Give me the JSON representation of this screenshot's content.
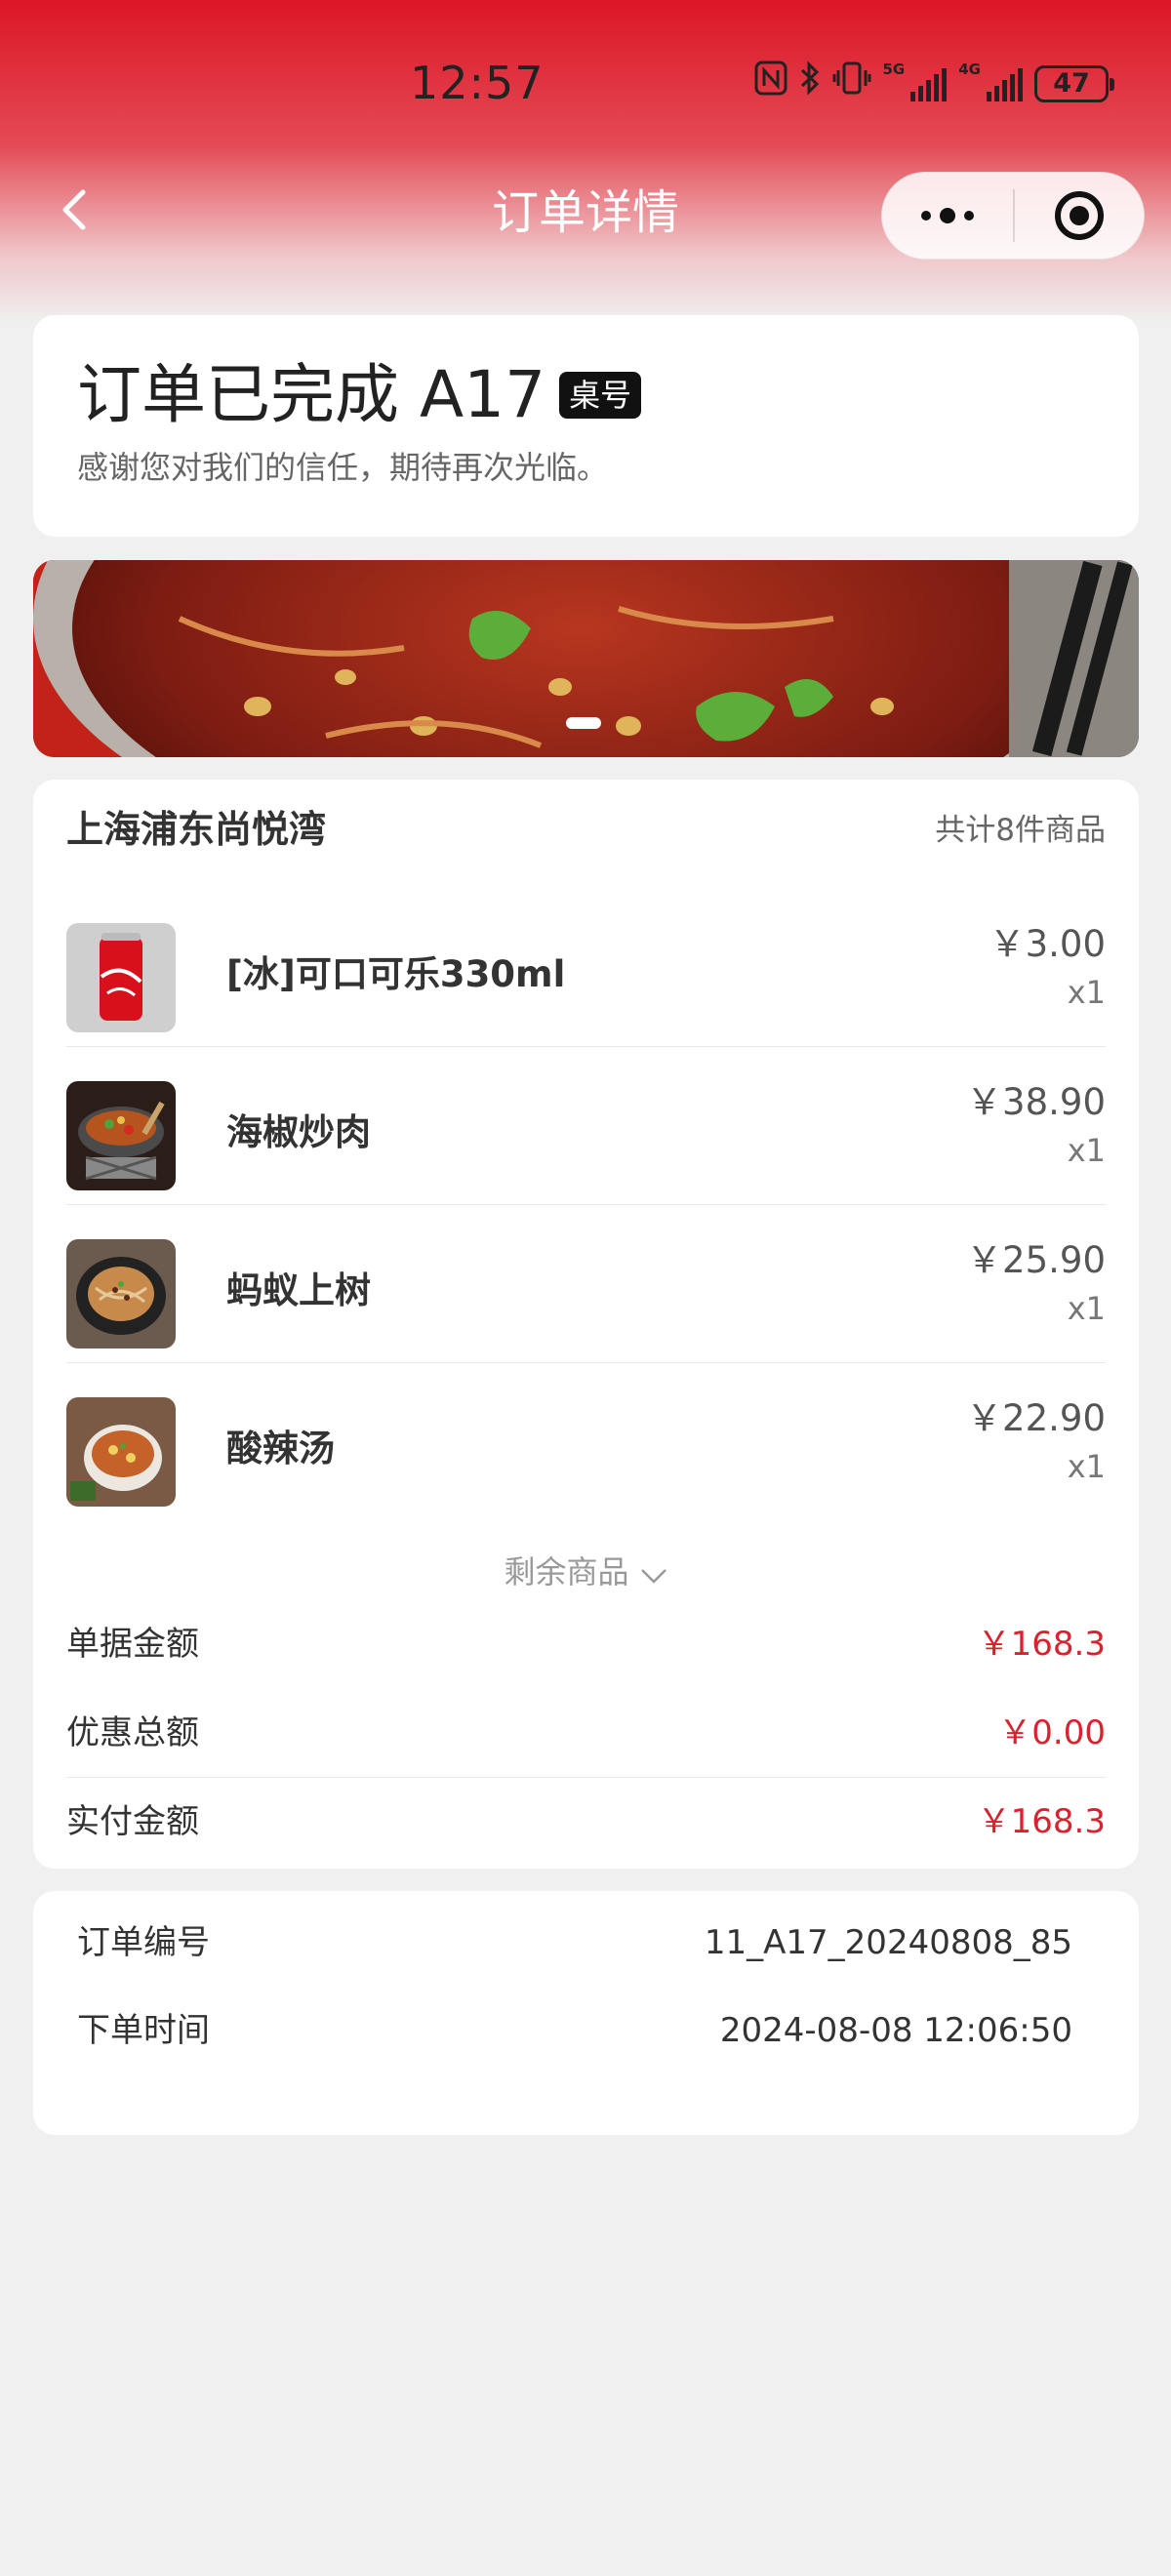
{
  "status_bar": {
    "time": "12:57",
    "battery": "47",
    "net1": "5G",
    "net2": "4G"
  },
  "nav": {
    "title": "订单详情"
  },
  "order_status": {
    "title": "订单已完成 A17",
    "badge": "桌号",
    "subtitle": "感谢您对我们的信任，期待再次光临。"
  },
  "store": {
    "name": "上海浦东尚悦湾",
    "item_count": "共计8件商品"
  },
  "items": [
    {
      "name": "[冰]可口可乐330ml",
      "price": "￥3.00",
      "qty": "x1",
      "image": "cola-can"
    },
    {
      "name": "海椒炒肉",
      "price": "￥38.90",
      "qty": "x1",
      "image": "stir-fried-pork"
    },
    {
      "name": "蚂蚁上树",
      "price": "￥25.90",
      "qty": "x1",
      "image": "ants-climbing-tree"
    },
    {
      "name": "酸辣汤",
      "price": "￥22.90",
      "qty": "x1",
      "image": "hot-sour-soup"
    }
  ],
  "more_items_label": "剩余商品",
  "summary": {
    "subtotal_label": "单据金额",
    "subtotal": "￥168.3",
    "discount_label": "优惠总额",
    "discount": "￥0.00",
    "paid_label": "实付金额",
    "paid": "￥168.3"
  },
  "order_info": {
    "number_label": "订单编号",
    "number": "11_A17_20240808_85",
    "time_label": "下单时间",
    "time": "2024-08-08 12:06:50"
  },
  "colors": {
    "accent": "#d8232f",
    "header": "#dc1626",
    "background": "#f0f0f0"
  }
}
